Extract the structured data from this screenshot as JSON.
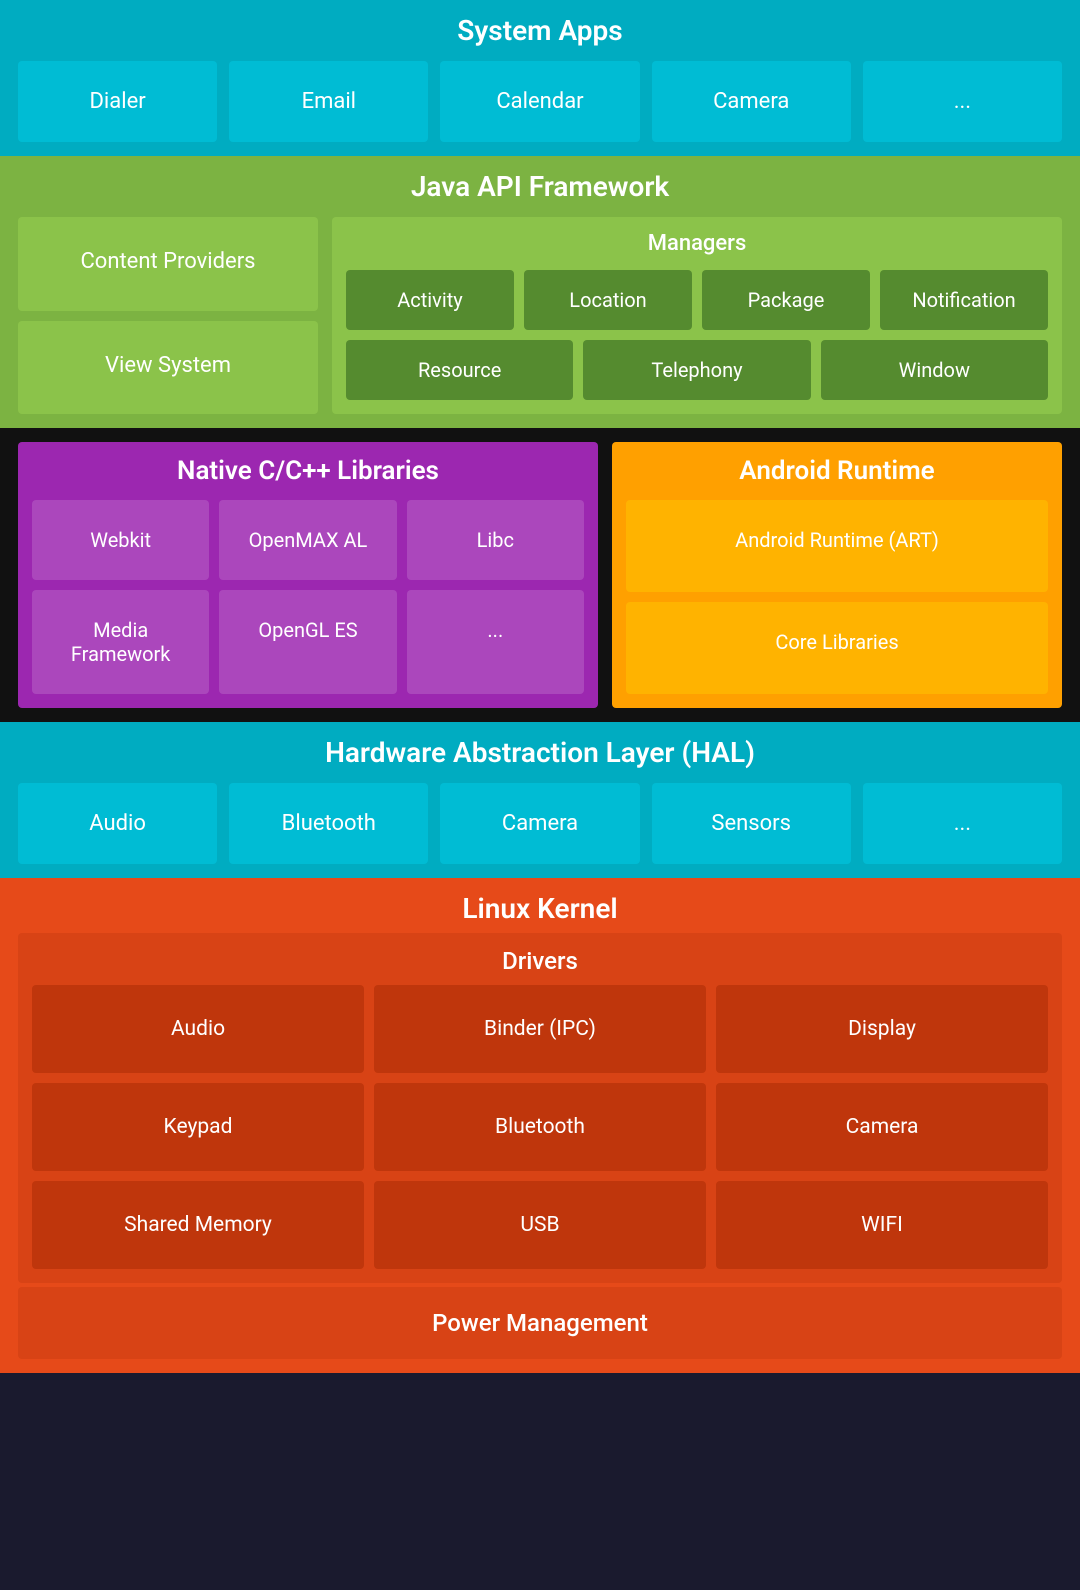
{
  "system_apps": {
    "title": "System Apps",
    "apps": [
      "Dialer",
      "Email",
      "Calendar",
      "Camera",
      "..."
    ]
  },
  "java_api": {
    "title": "Java API Framework",
    "left": {
      "items": [
        "Content Providers",
        "View System"
      ]
    },
    "right": {
      "managers_title": "Managers",
      "row1": [
        "Activity",
        "Location",
        "Package",
        "Notification"
      ],
      "row2": [
        "Resource",
        "Telephony",
        "Window"
      ]
    }
  },
  "native_cpp": {
    "title": "Native C/C++ Libraries",
    "items": [
      "Webkit",
      "OpenMAX AL",
      "Libc",
      "Media Framework",
      "OpenGL ES",
      "..."
    ]
  },
  "android_runtime": {
    "title": "Android Runtime",
    "items": [
      "Android Runtime (ART)",
      "Core Libraries"
    ]
  },
  "hal": {
    "title": "Hardware Abstraction Layer (HAL)",
    "items": [
      "Audio",
      "Bluetooth",
      "Camera",
      "Sensors",
      "..."
    ]
  },
  "linux_kernel": {
    "title": "Linux Kernel",
    "drivers_title": "Drivers",
    "drivers": [
      [
        "Audio",
        "Binder (IPC)",
        "Display"
      ],
      [
        "Keypad",
        "Bluetooth",
        "Camera"
      ],
      [
        "Shared Memory",
        "USB",
        "WIFI"
      ]
    ],
    "power_mgmt": "Power Management"
  }
}
